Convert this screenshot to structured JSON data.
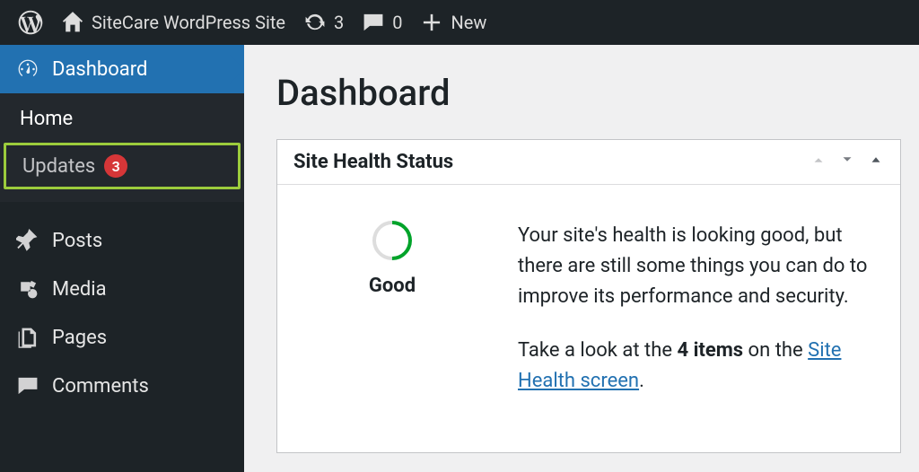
{
  "adminbar": {
    "site_name": "SiteCare WordPress Site",
    "updates_count": "3",
    "comments_count": "0",
    "new_label": "New"
  },
  "sidebar": {
    "dashboard": "Dashboard",
    "submenu": {
      "home": "Home",
      "updates": "Updates",
      "updates_badge": "3"
    },
    "posts": "Posts",
    "media": "Media",
    "pages": "Pages",
    "comments": "Comments"
  },
  "page": {
    "title": "Dashboard"
  },
  "health_panel": {
    "title": "Site Health Status",
    "gauge_label": "Good",
    "line1": "Your site's health is looking good, but there are still some things you can do to improve its performance and security.",
    "line2_prefix": "Take a look at the ",
    "line2_items": "4 items",
    "line2_mid": " on the ",
    "line2_link": "Site Health screen",
    "line2_suffix": "."
  }
}
